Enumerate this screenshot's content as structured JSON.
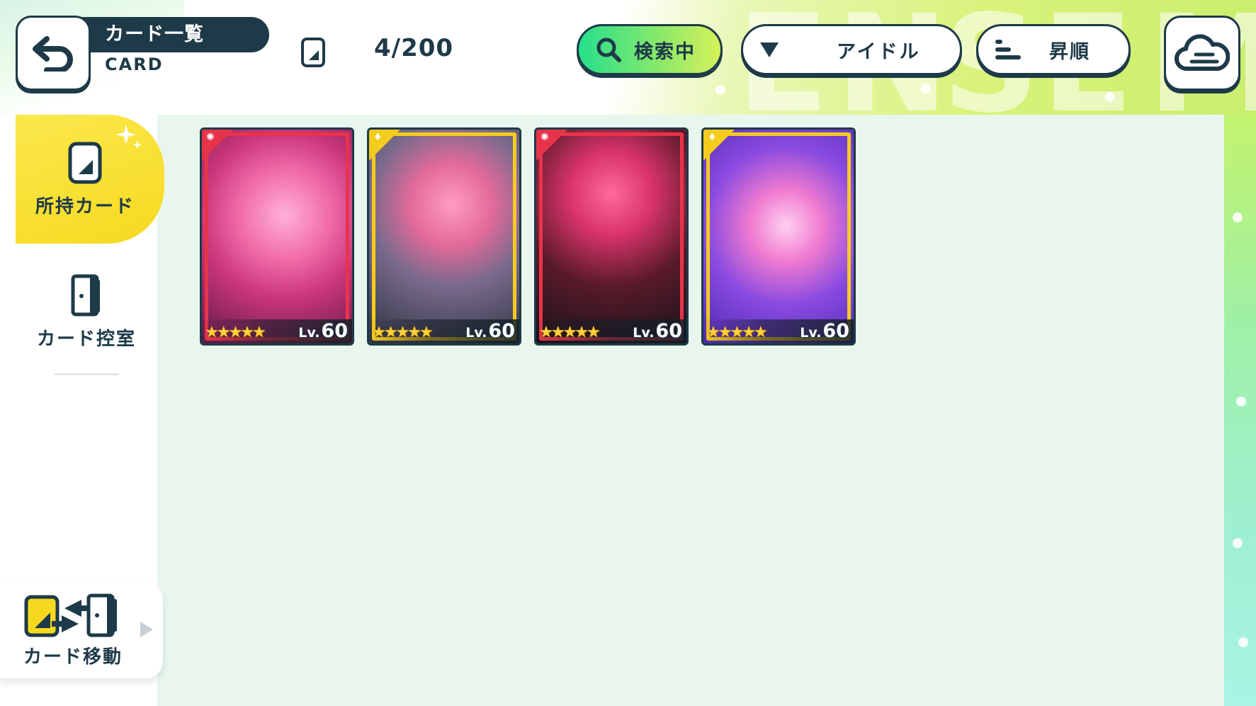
{
  "header": {
    "title": "カード一覧",
    "subtitle": "CARD",
    "card_count": "4/200"
  },
  "toolbar": {
    "search_label": "検索中",
    "filter_label": "アイドル",
    "sort_label": "昇順"
  },
  "sidebar": {
    "tabs": [
      {
        "label": "所持カード",
        "selected": true
      },
      {
        "label": "カード控室",
        "selected": false
      }
    ],
    "move_label": "カード移動"
  },
  "cards": [
    {
      "rarity_stars": 5,
      "level_prefix": "Lv.",
      "level": "60",
      "frame_color": "#e8344a",
      "attribute": "red"
    },
    {
      "rarity_stars": 5,
      "level_prefix": "Lv.",
      "level": "60",
      "frame_color": "#f4cc1e",
      "attribute": "yellow"
    },
    {
      "rarity_stars": 5,
      "level_prefix": "Lv.",
      "level": "60",
      "frame_color": "#e8344a",
      "attribute": "red"
    },
    {
      "rarity_stars": 5,
      "level_prefix": "Lv.",
      "level": "60",
      "frame_color": "#f4cc1e",
      "attribute": "yellow"
    }
  ],
  "colors": {
    "navy": "#1e3a48",
    "accent_yellow": "#f6d91f",
    "panel_bg": "#e8f6ee",
    "search_gradient_start": "#26e08c",
    "search_gradient_end": "#d6f25a"
  }
}
